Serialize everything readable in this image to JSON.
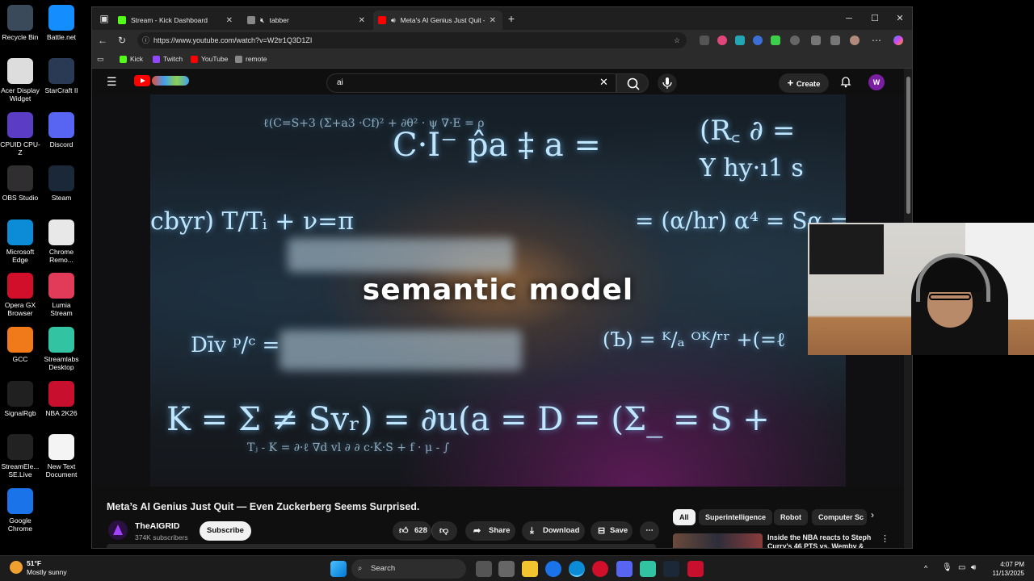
{
  "desktop": {
    "icons": [
      {
        "label": "Recycle Bin",
        "color": "#3a4a5a"
      },
      {
        "label": "Battle.net",
        "color": "#148eff"
      },
      {
        "label": "Acer Display Widget",
        "color": "#dddddd"
      },
      {
        "label": "StarCraft II",
        "color": "#2a3a55"
      },
      {
        "label": "CPUID CPU-Z",
        "color": "#5b3cc4"
      },
      {
        "label": "Discord",
        "color": "#5865f2"
      },
      {
        "label": "OBS Studio",
        "color": "#302e31"
      },
      {
        "label": "Steam",
        "color": "#1b2838"
      },
      {
        "label": "Microsoft Edge",
        "color": "#0c8bd6"
      },
      {
        "label": "Chrome Remo...",
        "color": "#e8e8e8"
      },
      {
        "label": "Opera GX Browser",
        "color": "#d10f2b"
      },
      {
        "label": "Lumia Stream",
        "color": "#e23b5a"
      },
      {
        "label": "GCC",
        "color": "#f07a1a"
      },
      {
        "label": "Streamlabs Desktop",
        "color": "#31c3a2"
      },
      {
        "label": "SignalRgb",
        "color": "#202020"
      },
      {
        "label": "NBA 2K26",
        "color": "#c8102e"
      },
      {
        "label": "StreamEle... SE.Live",
        "color": "#222222"
      },
      {
        "label": "New Text Document",
        "color": "#f4f4f4"
      },
      {
        "label": "Google Chrome",
        "color": "#1a73e8"
      }
    ]
  },
  "browser": {
    "tabs": [
      {
        "title": "Stream - Kick Dashboard",
        "fav_color": "#53fc18"
      },
      {
        "title": "tabber",
        "fav_color": "#888888"
      },
      {
        "title": "Meta's AI Genius Just Quit -",
        "fav_color": "#ff0000"
      }
    ],
    "window_controls": {
      "minimize": "─",
      "maximize": "☐",
      "close": "✕"
    },
    "new_tab": "+",
    "url": "https://www.youtube.com/watch?v=W2tr1Q3D1ZI",
    "bookmarks": [
      {
        "label": "Kick",
        "color": "#53fc18"
      },
      {
        "label": "Twitch",
        "color": "#9146ff"
      },
      {
        "label": "YouTube",
        "color": "#ff0000"
      },
      {
        "label": "remote",
        "color": "#888888"
      }
    ]
  },
  "youtube": {
    "search_query": "ai",
    "create_label": "Create",
    "avatar_letter": "W",
    "video": {
      "caption": "semantic model",
      "title": "Meta’s AI Genius Just Quit — Even Zuckerberg Seems Surprised.",
      "channel": "TheAIGRID",
      "subscribers": "374K subscribers",
      "subscribe_label": "Subscribe",
      "likes": "628",
      "share_label": "Share",
      "download_label": "Download",
      "save_label": "Save"
    },
    "chips": [
      "All",
      "Superintelligence",
      "Robot",
      "Computer Sc"
    ],
    "recommendation": {
      "title": "Inside the NBA reacts to Steph Curry's 46 PTS vs. Wemby &"
    }
  },
  "taskbar": {
    "weather_temp": "51°F",
    "weather_desc": "Mostly sunny",
    "search_label": "Search",
    "time": "4:07 PM",
    "date": "11/13/2025"
  }
}
